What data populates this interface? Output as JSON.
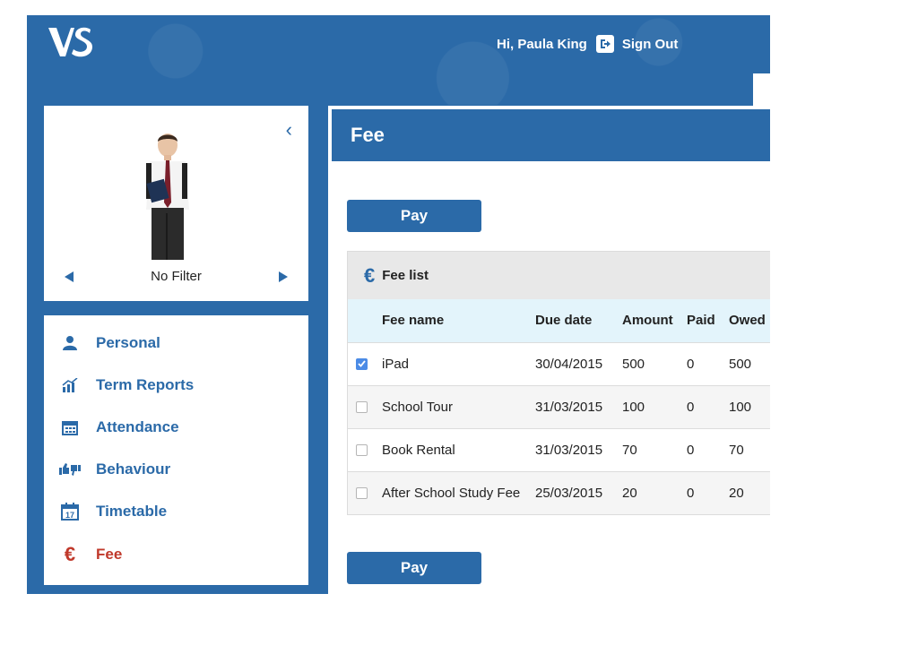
{
  "header": {
    "logo_text": "VS",
    "greeting": "Hi, Paula King",
    "signout_label": "Sign Out"
  },
  "profile": {
    "filter_label": "No Filter"
  },
  "menu": {
    "items": [
      {
        "label": "Personal",
        "icon": "person-icon"
      },
      {
        "label": "Term Reports",
        "icon": "chart-icon"
      },
      {
        "label": "Attendance",
        "icon": "calendar-grid-icon"
      },
      {
        "label": "Behaviour",
        "icon": "thumbs-icon"
      },
      {
        "label": "Timetable",
        "icon": "calendar-17-icon",
        "icon_text": "17"
      },
      {
        "label": "Fee",
        "icon": "euro-icon",
        "icon_text": "€",
        "active": true
      }
    ]
  },
  "page": {
    "title": "Fee",
    "pay_label": "Pay"
  },
  "fee_list": {
    "title": "Fee list",
    "icon_text": "€",
    "columns": [
      "Fee name",
      "Due date",
      "Amount",
      "Paid",
      "Owed"
    ],
    "rows": [
      {
        "name": "iPad",
        "due": "30/04/2015",
        "amount": "500",
        "paid": "0",
        "owed": "500",
        "checked": true
      },
      {
        "name": "School Tour",
        "due": "31/03/2015",
        "amount": "100",
        "paid": "0",
        "owed": "100",
        "checked": false
      },
      {
        "name": "Book Rental",
        "due": "31/03/2015",
        "amount": "70",
        "paid": "0",
        "owed": "70",
        "checked": false
      },
      {
        "name": "After School Study Fee",
        "due": "25/03/2015",
        "amount": "20",
        "paid": "0",
        "owed": "20",
        "checked": false
      }
    ]
  },
  "colors": {
    "brand_blue": "#2b6aa8",
    "active_red": "#c0392b",
    "table_header_bg": "#e3f4fb"
  }
}
